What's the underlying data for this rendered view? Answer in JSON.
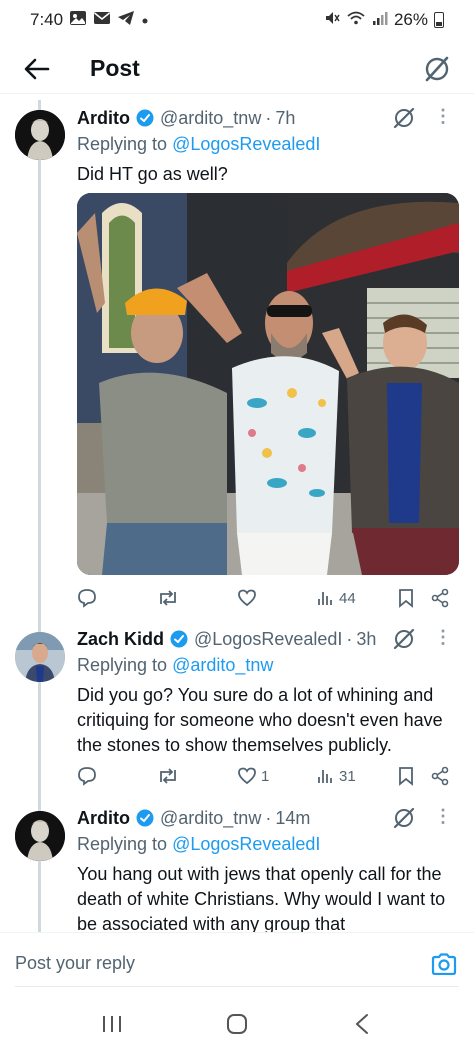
{
  "status_bar": {
    "time": "7:40",
    "battery": "26%",
    "left_icons": [
      "gallery-icon",
      "mail-icon",
      "telegram-icon",
      "dot-icon"
    ],
    "right_icons": [
      "mute-icon",
      "wifi-icon",
      "signal-icon",
      "battery-icon"
    ]
  },
  "header": {
    "title": "Post",
    "back_icon": "arrow-left-icon",
    "grok_icon": "grok-icon"
  },
  "tweets": [
    {
      "name": "Ardito",
      "handle": "@ardito_tnw",
      "time": "7h",
      "replying_prefix": "Replying to ",
      "replying_to": "@LogosRevealedI",
      "text": "Did HT go as well?",
      "has_photo": true,
      "likes": "",
      "views": "44",
      "retweets": "",
      "replies": ""
    },
    {
      "name": "Zach Kidd",
      "handle": "@LogosRevealedI",
      "time": "3h",
      "replying_prefix": "Replying to ",
      "replying_to": "@ardito_tnw",
      "text": "Did you go? You sure do a lot of whining and critiquing for someone who doesn't even have the stones to show themselves publicly.",
      "has_photo": false,
      "likes": "1",
      "views": "31",
      "retweets": "",
      "replies": ""
    },
    {
      "name": "Ardito",
      "handle": "@ardito_tnw",
      "time": "14m",
      "replying_prefix": "Replying to ",
      "replying_to": "@LogosRevealedI",
      "text": "You hang out with jews that openly call for the death of white Christians. Why would I want to be associated with any group that",
      "has_photo": false
    }
  ],
  "reply_bar": {
    "placeholder": "Post your reply",
    "camera_icon": "camera-icon"
  },
  "nav_bar": {
    "icons": [
      "recents-icon",
      "home-icon",
      "back-icon"
    ]
  },
  "colors": {
    "accent": "#1d9bf0",
    "text": "#0f1419",
    "secondary": "#536471",
    "thread_line": "#cfd9de"
  }
}
